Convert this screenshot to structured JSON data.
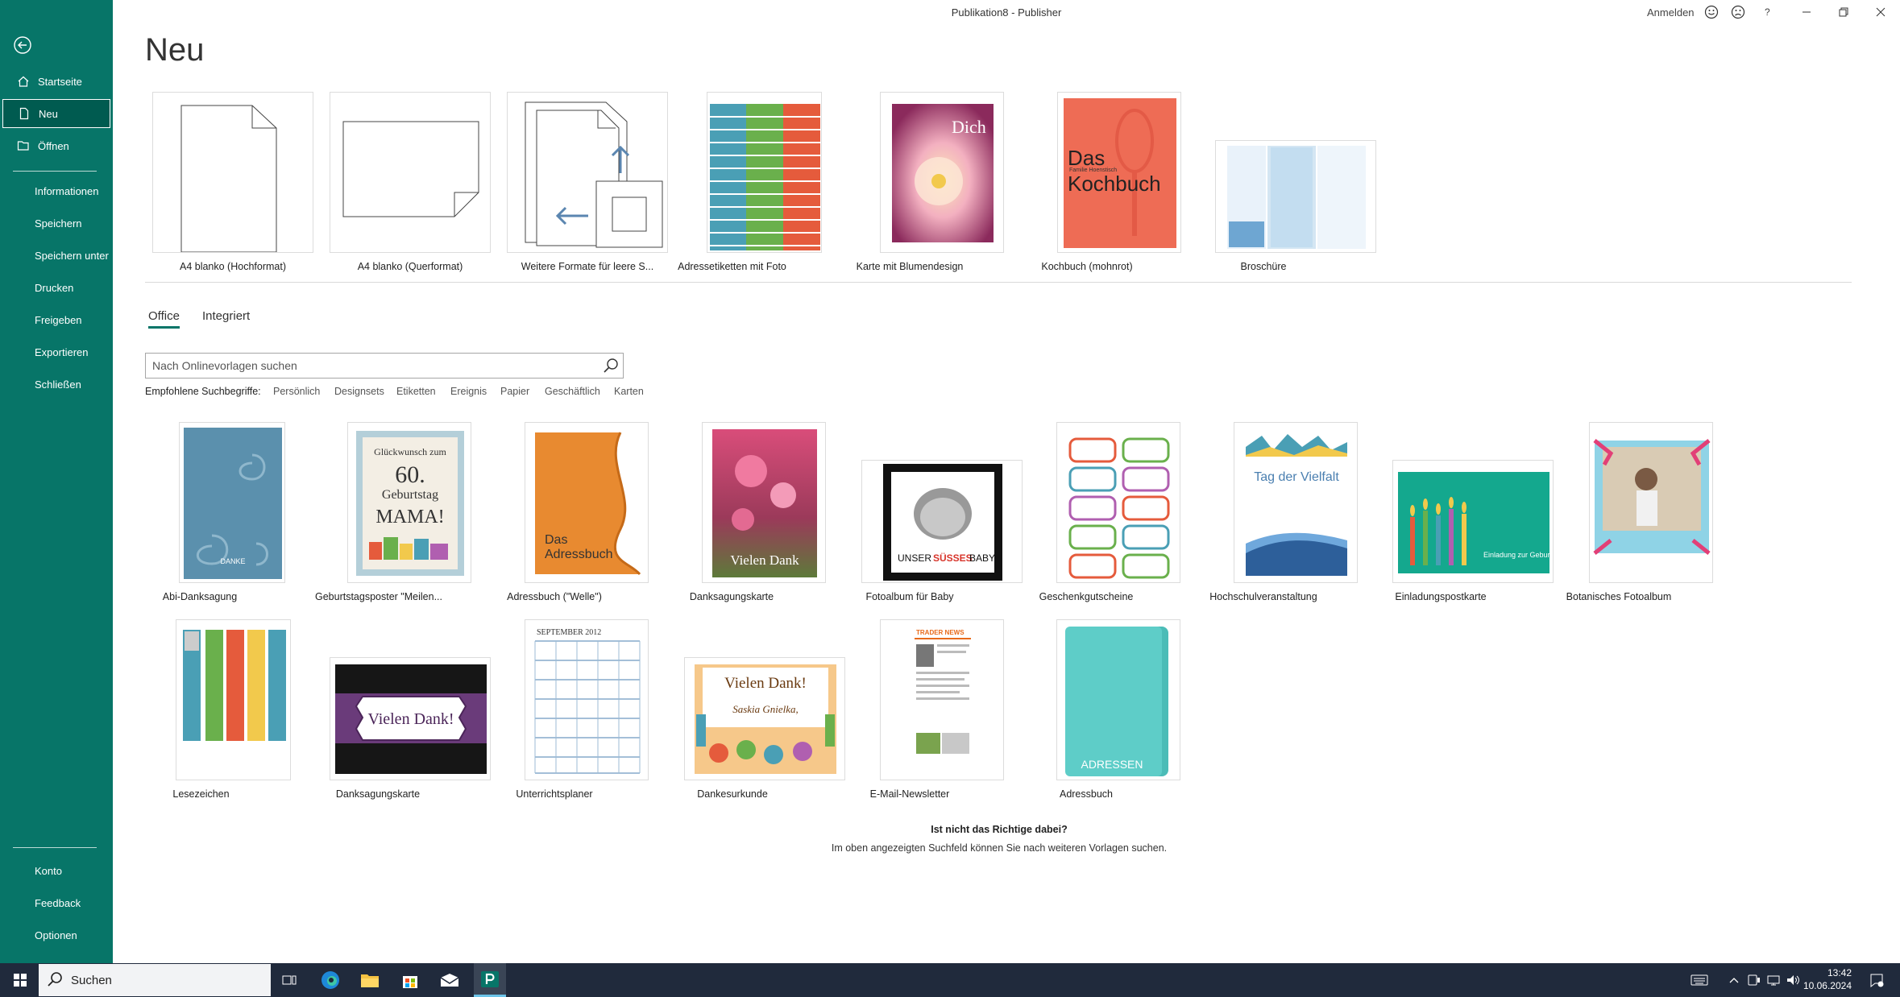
{
  "window": {
    "title": "Publikation8  -  Publisher",
    "signin": "Anmelden",
    "help": "?"
  },
  "nav": {
    "startseite": "Startseite",
    "neu": "Neu",
    "oeffnen": "Öffnen",
    "informationen": "Informationen",
    "speichern": "Speichern",
    "speichern_unter": "Speichern unter",
    "drucken": "Drucken",
    "freigeben": "Freigeben",
    "exportieren": "Exportieren",
    "schliessen": "Schließen",
    "konto": "Konto",
    "feedback": "Feedback",
    "optionen": "Optionen"
  },
  "page": {
    "title": "Neu"
  },
  "top_templates": [
    "A4 blanko (Hochformat)",
    "A4 blanko (Querformat)",
    "Weitere Formate für leere S...",
    "Adressetiketten mit Foto",
    "Karte mit Blumendesign",
    "Kochbuch (mohnrot)",
    "Broschüre"
  ],
  "tabs": {
    "office": "Office",
    "integriert": "Integriert"
  },
  "search": {
    "placeholder": "Nach Onlinevorlagen suchen"
  },
  "suggestions": {
    "label": "Empfohlene Suchbegriffe:",
    "items": [
      "Persönlich",
      "Designsets",
      "Etiketten",
      "Ereignis",
      "Papier",
      "Geschäftlich",
      "Karten"
    ]
  },
  "gallery": [
    "Abi-Danksagung",
    "Geburtstagsposter \"Meilen...",
    "Adressbuch (\"Welle\")",
    "Danksagungskarte",
    "Fotoalbum für Baby",
    "Geschenkgutscheine",
    "Hochschulveranstaltung",
    "Einladungspostkarte",
    "Botanisches Fotoalbum",
    "Lesezeichen",
    "Danksagungskarte",
    "Unterrichtsplaner",
    "Dankesurkunde",
    "E-Mail-Newsletter",
    "Adressbuch"
  ],
  "thumbs": {
    "kochbuch_1": "Das",
    "kochbuch_2": "Kochbuch",
    "kochbuch_sub": "Familie Hoenstisch",
    "dich": "Dich",
    "danke": "DANKE",
    "gb1": "Glückwunsch zum",
    "gb2": "60.",
    "gb3": "Geburtstag",
    "gb4": "MAMA!",
    "adr1": "Das",
    "adr2": "Adressbuch",
    "vd": "Vielen Dank",
    "baby1": "UNSER",
    "baby2": "SÜSSES",
    "baby3": "BABY",
    "vielfalt": "Tag der Vielfalt",
    "einl": "Einladung zur Geburtstagsparty!",
    "vd2": "Vielen Dank!",
    "sept": "SEPTEMBER 2012",
    "vd3": "Vielen Dank!",
    "saskia": "Saskia Gnielka,",
    "trader": "TRADER NEWS",
    "adressen": "ADRESSEN"
  },
  "footer": {
    "title": "Ist nicht das Richtige dabei?",
    "text": "Im oben angezeigten Suchfeld können Sie nach weiteren Vorlagen suchen."
  },
  "taskbar": {
    "search": "Suchen",
    "time": "13:42",
    "date": "10.06.2024"
  },
  "colors": {
    "sidebar": "#077568",
    "taskbar": "#202a3c",
    "accent": "#077568"
  }
}
